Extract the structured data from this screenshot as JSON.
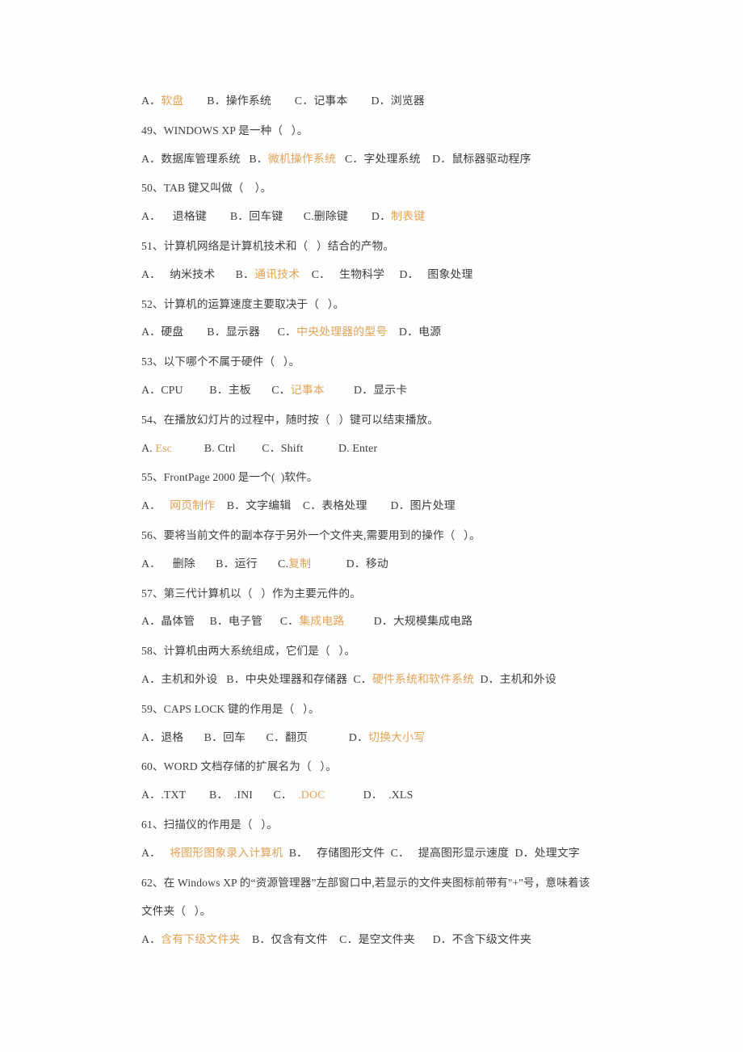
{
  "document": {
    "kind": "scanned-exam-page",
    "language": "zh-CN",
    "page_background": "#fefefe",
    "text_color": "#3d3d3d",
    "highlight_color": "#e2a154",
    "lines": [
      {
        "id": "q48-options",
        "type": "options",
        "segments": [
          {
            "text": "A．",
            "style": "key"
          },
          {
            "text": "软盘",
            "style": "highlight"
          },
          {
            "text": "        B．操作系统        C．记事本        D．浏览器",
            "style": "plain"
          }
        ]
      },
      {
        "id": "q49-stem",
        "type": "question",
        "segments": [
          {
            "text": "49、WINDOWS XP 是一种（   ）。",
            "style": "plain"
          }
        ]
      },
      {
        "id": "q49-options",
        "type": "options",
        "segments": [
          {
            "text": "A．数据库管理系统   B．",
            "style": "plain"
          },
          {
            "text": "微机操作系统",
            "style": "highlight"
          },
          {
            "text": "   C．字处理系统    D．鼠标器驱动程序",
            "style": "plain"
          }
        ]
      },
      {
        "id": "q50-stem",
        "type": "question",
        "segments": [
          {
            "text": "50、TAB 键又叫做（    ）。",
            "style": "plain"
          }
        ]
      },
      {
        "id": "q50-options",
        "type": "options",
        "segments": [
          {
            "text": "A．    退格键        B．回车键       C.删除键        D．",
            "style": "plain"
          },
          {
            "text": "制表键",
            "style": "highlight"
          }
        ]
      },
      {
        "id": "q51-stem",
        "type": "question",
        "segments": [
          {
            "text": "51、计算机网络是计算机技术和（   ）结合的产物。",
            "style": "plain"
          }
        ]
      },
      {
        "id": "q51-options",
        "type": "options",
        "segments": [
          {
            "text": "A．   纳米技术       B．",
            "style": "plain"
          },
          {
            "text": "通讯技术",
            "style": "highlight"
          },
          {
            "text": "    C．   生物科学     D．   图象处理",
            "style": "plain"
          }
        ]
      },
      {
        "id": "q52-stem",
        "type": "question",
        "segments": [
          {
            "text": "52、计算机的运算速度主要取决于（   ）。",
            "style": "plain"
          }
        ]
      },
      {
        "id": "q52-options",
        "type": "options",
        "segments": [
          {
            "text": "A．硬盘        B．显示器      C．",
            "style": "plain"
          },
          {
            "text": "中央处理器的型号",
            "style": "highlight"
          },
          {
            "text": "    D．电源",
            "style": "plain"
          }
        ]
      },
      {
        "id": "q53-stem",
        "type": "question",
        "segments": [
          {
            "text": "53、以下哪个不属于硬件（   ）。",
            "style": "plain"
          }
        ]
      },
      {
        "id": "q53-options",
        "type": "options",
        "segments": [
          {
            "text": "A．CPU         B．主板       C．",
            "style": "plain"
          },
          {
            "text": "记事本",
            "style": "highlight"
          },
          {
            "text": "          D．显示卡",
            "style": "plain"
          }
        ]
      },
      {
        "id": "q54-stem",
        "type": "question",
        "segments": [
          {
            "text": "54、在播放幻灯片的过程中，随时按（   ）键可以结束播放。",
            "style": "plain"
          }
        ]
      },
      {
        "id": "q54-options",
        "type": "options",
        "segments": [
          {
            "text": "A. ",
            "style": "plain"
          },
          {
            "text": "Esc",
            "style": "highlight"
          },
          {
            "text": "           B. Ctrl         C．Shift            D. Enter",
            "style": "plain"
          }
        ]
      },
      {
        "id": "q55-stem",
        "type": "question",
        "segments": [
          {
            "text": "55、FrontPage 2000 是一个(  )软件。",
            "style": "plain"
          }
        ]
      },
      {
        "id": "q55-options",
        "type": "options",
        "segments": [
          {
            "text": "A．   ",
            "style": "plain"
          },
          {
            "text": "网页制作",
            "style": "highlight"
          },
          {
            "text": "    B．文字编辑    C．表格处理        D．图片处理",
            "style": "plain"
          }
        ]
      },
      {
        "id": "q56-stem",
        "type": "question",
        "segments": [
          {
            "text": "56、要将当前文件的副本存于另外一个文件夹,需要用到的操作（   ）。",
            "style": "plain"
          }
        ]
      },
      {
        "id": "q56-options",
        "type": "options",
        "segments": [
          {
            "text": "A．    删除       B．运行       C.",
            "style": "plain"
          },
          {
            "text": "复制",
            "style": "highlight"
          },
          {
            "text": "            D．移动",
            "style": "plain"
          }
        ]
      },
      {
        "id": "q57-stem",
        "type": "question",
        "segments": [
          {
            "text": "57、第三代计算机以（   ）作为主要元件的。",
            "style": "plain"
          }
        ]
      },
      {
        "id": "q57-options",
        "type": "options",
        "segments": [
          {
            "text": "A．晶体管     B．电子管      C．",
            "style": "plain"
          },
          {
            "text": "集成电路",
            "style": "highlight"
          },
          {
            "text": "          D．大规模集成电路",
            "style": "plain"
          }
        ]
      },
      {
        "id": "q58-stem",
        "type": "question",
        "segments": [
          {
            "text": "58、计算机由两大系统组成，它们是（   ）。",
            "style": "plain"
          }
        ]
      },
      {
        "id": "q58-options",
        "type": "options",
        "segments": [
          {
            "text": "A．主机和外设   B．中央处理器和存储器  C．",
            "style": "plain"
          },
          {
            "text": "硬件系统和软件系统",
            "style": "highlight"
          },
          {
            "text": "  D．主机和外设",
            "style": "plain"
          }
        ]
      },
      {
        "id": "q59-stem",
        "type": "question",
        "segments": [
          {
            "text": "59、CAPS LOCK 键的作用是（   ）。",
            "style": "plain"
          }
        ]
      },
      {
        "id": "q59-options",
        "type": "options",
        "segments": [
          {
            "text": "A．退格       B．回车       C．翻页              D．",
            "style": "plain"
          },
          {
            "text": "切换大小写",
            "style": "highlight"
          }
        ]
      },
      {
        "id": "q60-stem",
        "type": "question",
        "segments": [
          {
            "text": "60、WORD 文档存储的扩展名为（   ）。",
            "style": "plain"
          }
        ]
      },
      {
        "id": "q60-options",
        "type": "options",
        "segments": [
          {
            "text": "A．.TXT        B．  .INI       C．  ",
            "style": "plain"
          },
          {
            "text": ".DOC",
            "style": "highlight"
          },
          {
            "text": "             D．  .XLS",
            "style": "plain"
          }
        ]
      },
      {
        "id": "q61-stem",
        "type": "question",
        "segments": [
          {
            "text": "61、扫描仪的作用是（   ）。",
            "style": "plain"
          }
        ]
      },
      {
        "id": "q61-options",
        "type": "options",
        "segments": [
          {
            "text": "A．   ",
            "style": "plain"
          },
          {
            "text": "将图形图象录入计算机",
            "style": "highlight"
          },
          {
            "text": "  B．   存储图形文件  C．   提高图形显示速度  D．处理文字",
            "style": "plain"
          }
        ]
      },
      {
        "id": "q62-stem-line1",
        "type": "question",
        "segments": [
          {
            "text": "62、在 Windows XP 的“资源管理器”左部窗口中,若显示的文件夹图标前带有\"+\"号，意味着该",
            "style": "plain"
          }
        ]
      },
      {
        "id": "q62-stem-line2",
        "type": "question-continuation",
        "segments": [
          {
            "text": "文件夹（   ）。",
            "style": "plain"
          }
        ]
      },
      {
        "id": "q62-options",
        "type": "options",
        "segments": [
          {
            "text": "A．",
            "style": "plain"
          },
          {
            "text": "含有下级文件夹",
            "style": "highlight"
          },
          {
            "text": "    B．仅含有文件    C．是空文件夹      D．不含下级文件夹",
            "style": "plain"
          }
        ]
      }
    ]
  }
}
